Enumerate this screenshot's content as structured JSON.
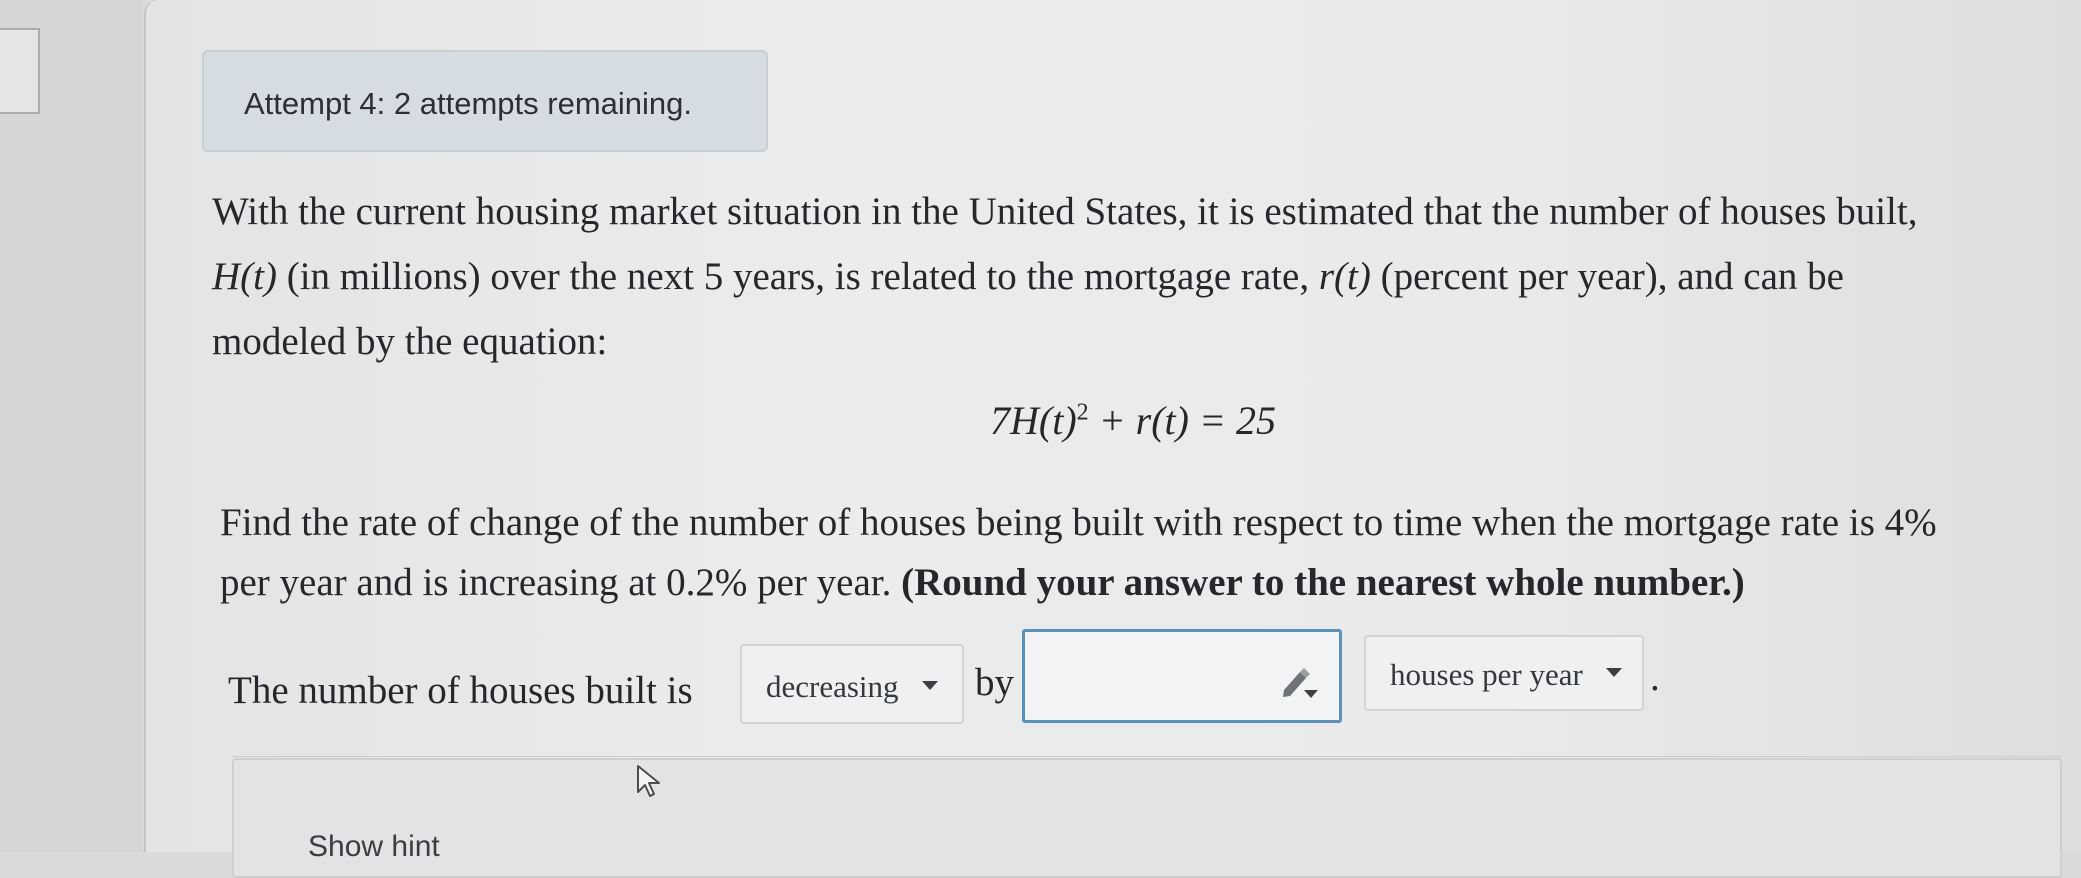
{
  "attempt": {
    "text": "Attempt 4: 2 attempts remaining."
  },
  "problem": {
    "line1": "With the current housing market situation in the United States, it is estimated that the number of houses built,",
    "line2_func": "H(t)",
    "line2_a": " (in millions) over the next 5 years, is related to the mortgage rate, ",
    "line2_func2": "r(t)",
    "line2_b": " (percent per year), and can be",
    "line3": "modeled by the equation:",
    "equation_lead": "7H(t)",
    "equation_exp": "2",
    "equation_tail": " + r(t) = 25",
    "question_line1": "Find the rate of change of the number of houses being built with respect to time when the mortgage rate is 4%",
    "question_line2_plain": "per year and is increasing at 0.2% per year. ",
    "question_line2_bold": "(Round your answer to the nearest whole number.)"
  },
  "answer": {
    "prefix": "The number of houses built is",
    "direction_selected": "decreasing",
    "connector": "by",
    "value": "",
    "unit_selected": "houses per year",
    "suffix": "."
  },
  "hint": {
    "label": "Show hint"
  },
  "icons": {
    "dropdown": "caret-down-icon",
    "input_tool": "pencil-icon",
    "cursor": "mouse-pointer-icon"
  }
}
